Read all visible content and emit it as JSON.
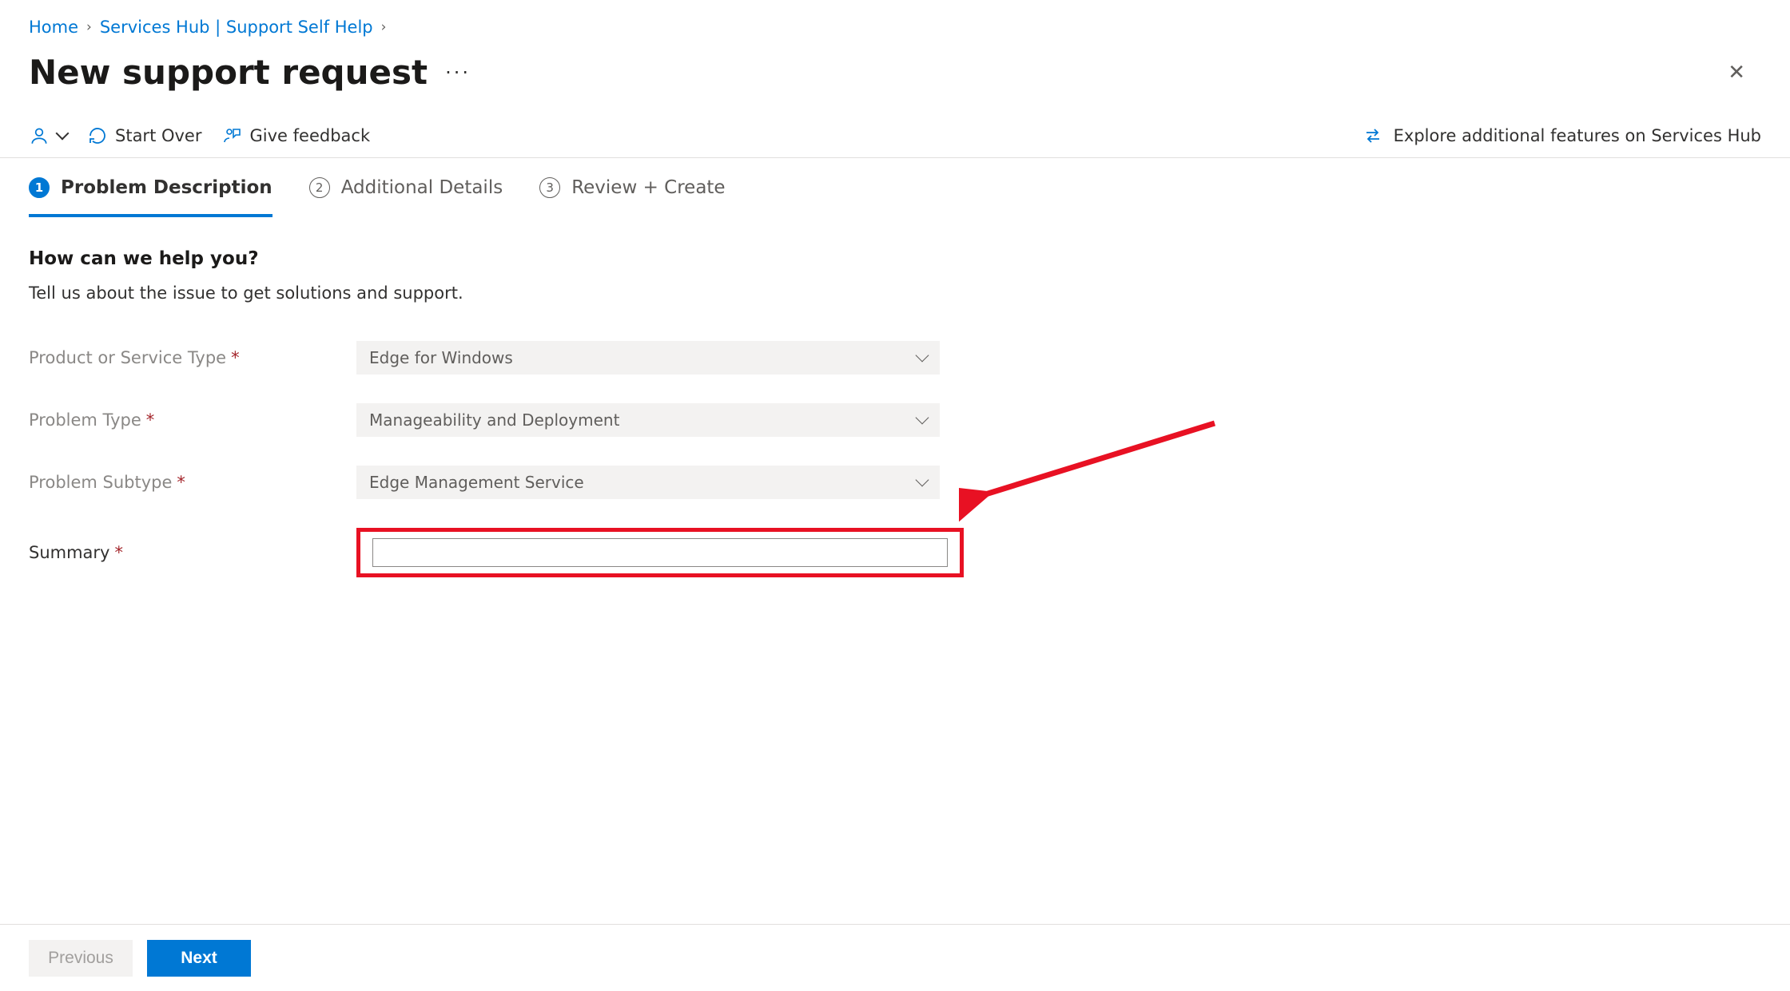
{
  "breadcrumb": {
    "home": "Home",
    "service": "Services Hub | Support Self Help"
  },
  "header": {
    "title": "New support request",
    "more_label": "···",
    "close_label": "✕"
  },
  "toolbar": {
    "start_over": "Start Over",
    "feedback": "Give feedback",
    "explore": "Explore additional features on Services Hub"
  },
  "tabs": {
    "t1": {
      "num": "1",
      "label": "Problem Description"
    },
    "t2": {
      "num": "2",
      "label": "Additional Details"
    },
    "t3": {
      "num": "3",
      "label": "Review + Create"
    }
  },
  "form": {
    "heading": "How can we help you?",
    "sub": "Tell us about the issue to get solutions and support.",
    "product_label": "Product or Service Type",
    "product_value": "Edge for Windows",
    "problem_type_label": "Problem Type",
    "problem_type_value": "Manageability and Deployment",
    "problem_subtype_label": "Problem Subtype",
    "problem_subtype_value": "Edge Management Service",
    "summary_label": "Summary",
    "summary_value": ""
  },
  "footer": {
    "prev": "Previous",
    "next": "Next"
  },
  "annotation": {
    "color": "#e81123"
  }
}
